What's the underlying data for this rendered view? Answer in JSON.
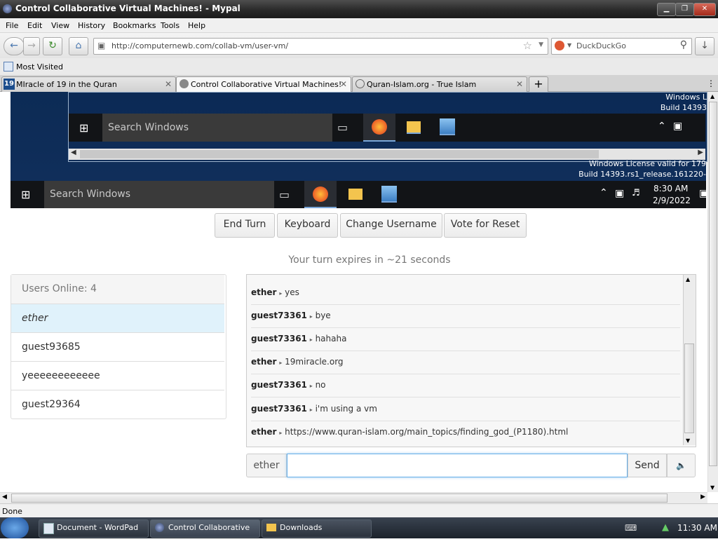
{
  "window": {
    "title": "Control Collaborative Virtual Machines! - Mypal"
  },
  "menubar": [
    "File",
    "Edit",
    "View",
    "History",
    "Bookmarks",
    "Tools",
    "Help"
  ],
  "address": {
    "url": "http://computernewb.com/collab-vm/user-vm/"
  },
  "search": {
    "engine": "DuckDuckGo"
  },
  "bookmarks": {
    "most_visited": "Most Visited"
  },
  "tabs": [
    {
      "label": "MIracle of 19 in the Quran",
      "icon": "19"
    },
    {
      "label": "Control Collaborative Virtual Machines!"
    },
    {
      "label": "Quran-Islam.org - True Islam"
    }
  ],
  "vm": {
    "inner_license": "Windows L",
    "inner_build": "Build 14393",
    "inner_search": "Search Windows",
    "outer_license": "Windows License valid for 179",
    "outer_build": "Build 14393.rs1_release.161220-",
    "outer_search": "Search Windows",
    "clock_time": "8:30 AM",
    "clock_date": "2/9/2022"
  },
  "controls": {
    "end_turn": "End Turn",
    "keyboard": "Keyboard",
    "change_username": "Change Username",
    "vote_reset": "Vote for Reset"
  },
  "turn_status": "Your turn expires in ~21 seconds",
  "users": {
    "header": "Users Online: 4",
    "list": [
      "ether",
      "guest93685",
      "yeeeeeeeeeeee",
      "guest29364"
    ]
  },
  "chat": {
    "messages": [
      {
        "user": "ether",
        "text": "yes"
      },
      {
        "user": "guest73361",
        "text": "bye"
      },
      {
        "user": "guest73361",
        "text": "hahaha"
      },
      {
        "user": "ether",
        "text": "19miracle.org"
      },
      {
        "user": "guest73361",
        "text": "no"
      },
      {
        "user": "guest73361",
        "text": "i'm using a vm"
      },
      {
        "user": "ether",
        "text": "https://www.quran-islam.org/main_topics/finding_god_(P1180).html"
      }
    ],
    "username": "ether",
    "input_value": "",
    "send_label": "Send"
  },
  "statusbar": {
    "text": "Done"
  },
  "os_taskbar": {
    "items": [
      "Document - WordPad",
      "Control Collaborative ...",
      "Downloads"
    ],
    "clock": "11:30 AM"
  }
}
